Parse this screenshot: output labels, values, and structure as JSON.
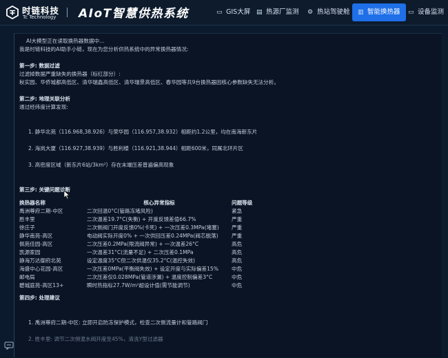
{
  "brand": {
    "name": "时链科技",
    "name_en": "Tc Technology",
    "system_title": "AIoT智慧供热系统"
  },
  "nav": [
    {
      "label": "GIS大屏",
      "icon": "monitor-icon"
    },
    {
      "label": "热源厂监测",
      "icon": "building-icon"
    },
    {
      "label": "热站驾驶舱",
      "icon": "gear-icon"
    },
    {
      "label": "智能换热器",
      "icon": "bar-chart-icon",
      "active": true
    },
    {
      "label": "设备监测",
      "icon": "screen-icon"
    }
  ],
  "report": {
    "loading": "AI大模型正在读取换热器数据中...",
    "intro": "我是时链科技的AI助手小链，现在为您分析供热系统中的异常换热器情况:",
    "step1_title": "第一步: 数据过滤",
    "step1_lines": [
      "过滤掉数据严重缺失的换热器（标红部分）:",
      "秋实园、华侨城都高低区、清华瑞鑫高低区、清华瑞景高低区、春华园等共9台换热器因核心参数缺失无法分析。"
    ],
    "step2_title": "第二步: 地理关联分析",
    "step2_intro": "通过经纬度计算发现:",
    "step2_items": [
      "1. 静华北苑（116.968,38.926）与荣华园（116.957,38.932）相距约1.2公里，均在南海新东片",
      "2. 海岚大厦（116.927,38.939）与胜利楼（116.921,38.944）相距600米，同属北环片区",
      "3. 高密度区域（新东片6站/3km²）存在末端压差普遍偏高现象"
    ],
    "step3_title": "第三步: 关键问题诊断",
    "table": {
      "headers": [
        "换热器名称",
        "核心异常指标",
        "问题等级"
      ],
      "rows": [
        [
          "禹洲尊府二期-中区",
          "二次回温0°C(管路冻堵风险)",
          "紧急"
        ],
        [
          "胜丰里",
          "二次温差19.7°C(失衡) + 开度反馈差值66.7%",
          "严重"
        ],
        [
          "徐庄子",
          "二次侧阀门开度反馈0%(卡死) + 一次压差0.3MPa(堵塞)",
          "严重"
        ],
        [
          "静华南苑-高区",
          "电动阀实际开度0% + 一次供回压差0.24MPa(阀芯脱落)",
          "严重"
        ],
        [
          "佩苑佳园-高区",
          "二次压差0.2MPa(限流阀异常) + 一次温差26°C",
          "高危"
        ],
        [
          "凯源家园",
          "一次温差31°C(流量不足) + 二次压差0.1MPa",
          "高危"
        ],
        [
          "静海万达御府北苑",
          "设定温度35°C但二次供温仅35.2°C(温控失效)",
          "高危"
        ],
        [
          "海盛中心花园-高区",
          "一次压差0MPa(平衡阀失效) + 设定开度与实际偏差15%",
          "中危"
        ],
        [
          "邮电局",
          "二次压差仅0.028MPa(管道涉漏) + 温度控制偏差3°C",
          "中危"
        ],
        [
          "碧城庭苑-高区13+",
          "瞬时热指标27.7W/m²超设计值(需节能调节)",
          "中危"
        ]
      ]
    },
    "step4_title": "第四步: 处理建议",
    "step4_items": [
      "1. 禹洲尊府二期-中区: 立即开启防冻保护模式，检查二次侧流量计和管路阀门",
      "2. 胜丰里: 调节二次侧混水阀开度至45%，清洗Y型过滤器"
    ]
  }
}
